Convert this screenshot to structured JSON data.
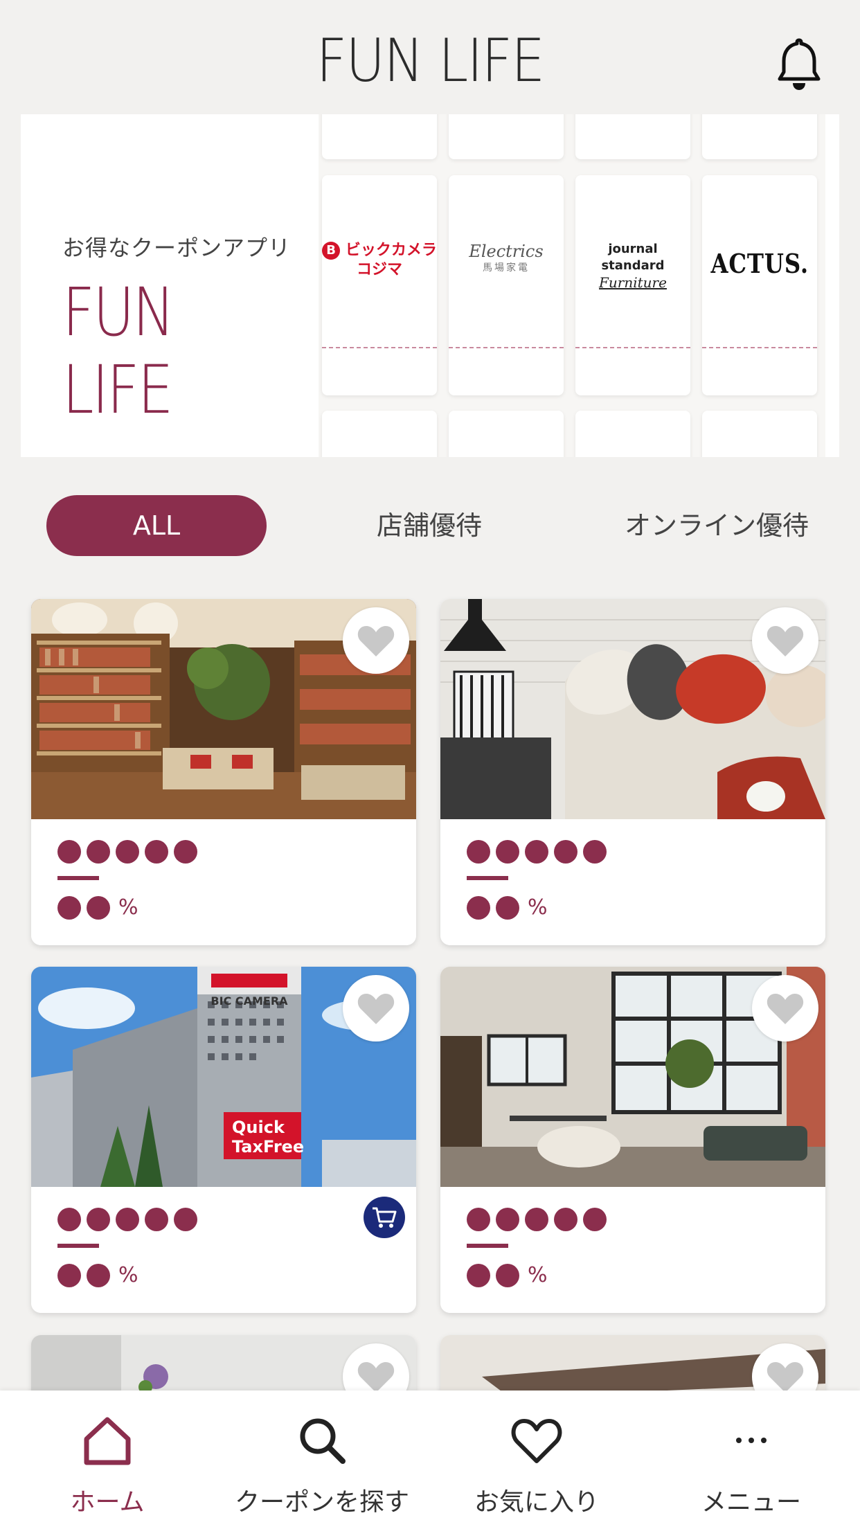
{
  "header": {
    "app_title": "FUN LIFE",
    "bell_icon": "bell-icon"
  },
  "banner": {
    "subtitle": "お得なクーポンアプリ",
    "logo_text": "FUN LIFE",
    "brands": [
      {
        "name": "ビックカメラ コジマ",
        "line1": "ビックカメラ",
        "line2": "コジマ",
        "color": "#d3132a"
      },
      {
        "name": "Electrics 馬場家電",
        "line1": "Electrics",
        "line2": "馬場家電",
        "color": "#555555"
      },
      {
        "name": "journal standard Furniture",
        "line1": "journal standard",
        "line2": "Furniture",
        "color": "#222222"
      },
      {
        "name": "ACTUS",
        "line1": "ACTUS.",
        "line2": "",
        "color": "#111111"
      }
    ]
  },
  "tabs": [
    {
      "label": "ALL",
      "active": true
    },
    {
      "label": "店舗優待",
      "active": false
    },
    {
      "label": "オンライン優待",
      "active": false
    }
  ],
  "cards": [
    {
      "scene": "bookstore",
      "title_dots": 5,
      "value_dots": 2,
      "unit": "%",
      "has_cart": false
    },
    {
      "scene": "sofa",
      "title_dots": 5,
      "value_dots": 2,
      "unit": "%",
      "has_cart": false
    },
    {
      "scene": "store-building",
      "title_dots": 5,
      "value_dots": 2,
      "unit": "%",
      "has_cart": true,
      "building_label": "BIC CAMERA",
      "sign_line1": "Quick",
      "sign_line2": "TaxFree"
    },
    {
      "scene": "loft",
      "title_dots": 5,
      "value_dots": 2,
      "unit": "%",
      "has_cart": false
    }
  ],
  "bottom_nav": [
    {
      "label": "ホーム",
      "icon": "home-icon",
      "active": true
    },
    {
      "label": "クーポンを探す",
      "icon": "search-icon",
      "active": false
    },
    {
      "label": "お気に入り",
      "icon": "heart-icon",
      "active": false
    },
    {
      "label": "メニュー",
      "icon": "more-icon",
      "active": false
    }
  ],
  "colors": {
    "accent": "#8b2e4d",
    "background": "#f2f1ef",
    "cart_badge": "#1b2a7a"
  }
}
